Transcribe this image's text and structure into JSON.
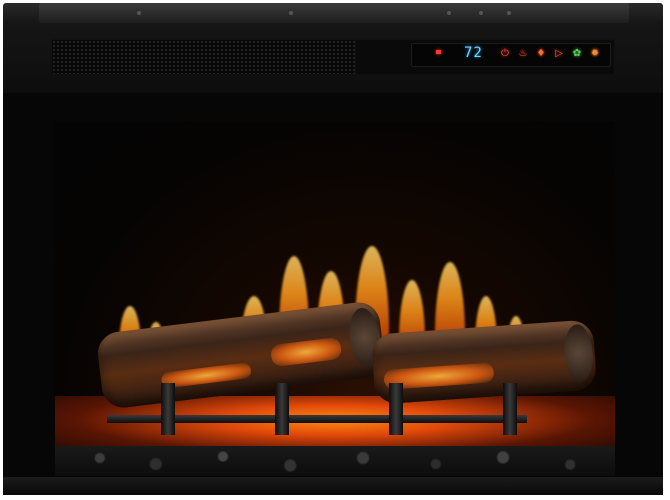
{
  "control_panel": {
    "temperature": "72",
    "indicator_color": "#ff3a2a",
    "display_color": "#6fd4ff",
    "buttons": [
      {
        "icon": "power-icon",
        "glyph": "⏻",
        "color": "#ff4a3a"
      },
      {
        "icon": "heat-icon",
        "glyph": "♨",
        "color": "#ff5a2a"
      },
      {
        "icon": "flame-icon",
        "glyph": "♦",
        "color": "#ff6a2a"
      },
      {
        "icon": "timer-icon",
        "glyph": "▷",
        "color": "#ff5030"
      },
      {
        "icon": "fan-icon",
        "glyph": "✿",
        "color": "#5ad15a"
      },
      {
        "icon": "brightness-icon",
        "glyph": "✹",
        "color": "#ff8a2a"
      }
    ]
  },
  "colors": {
    "frame": "#0d0d0d",
    "flame": "#ff9a1c",
    "ember": "#e0480a"
  }
}
